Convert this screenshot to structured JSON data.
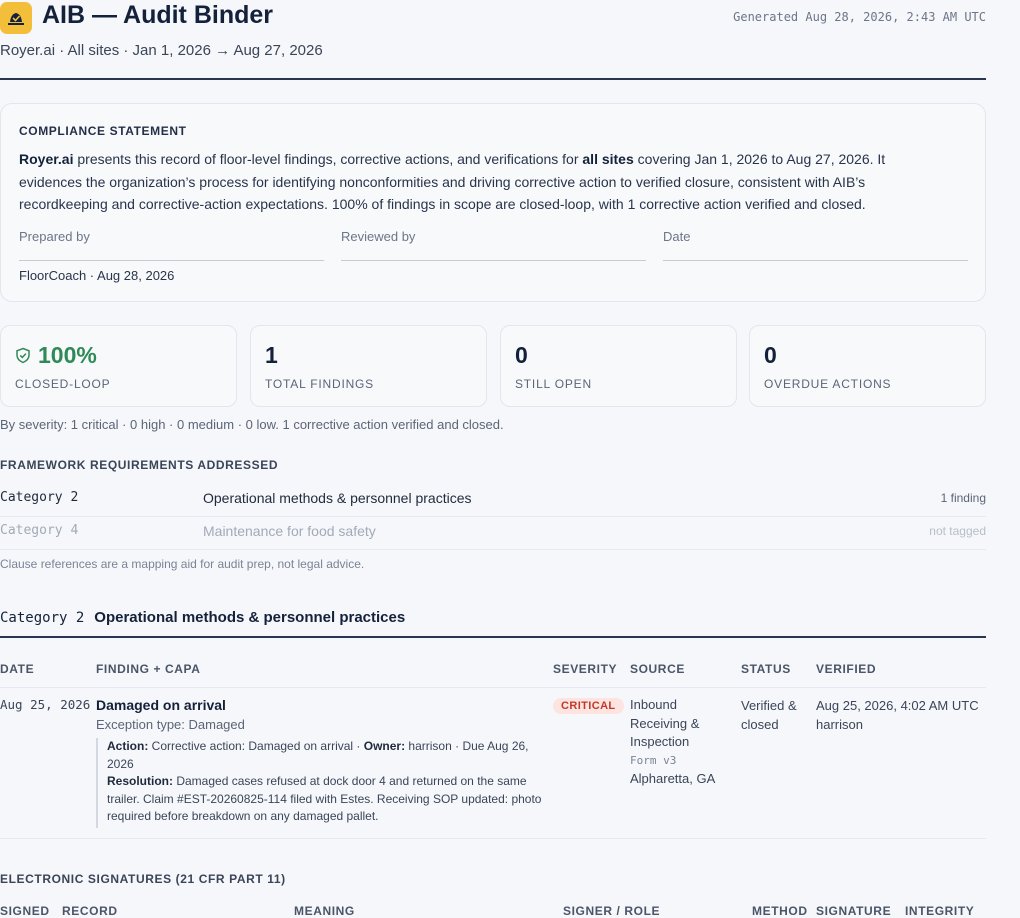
{
  "header": {
    "title": "AIB — Audit Binder",
    "generated": "Generated Aug 28, 2026, 2:43 AM UTC",
    "scope": "Royer.ai · All sites · Jan 1, 2026 → Aug 27, 2026",
    "logo_icon": "hardhat-icon",
    "logo_color": "#f3be3a"
  },
  "compliance": {
    "heading": "COMPLIANCE STATEMENT",
    "org": "Royer.ai",
    "text_1": " presents this record of floor-level findings, corrective actions, and verifications for ",
    "sites": "all sites",
    "text_2": " covering Jan 1, 2026 to Aug 27, 2026. It evidences the organization’s process for identifying nonconformities and driving corrective action to verified closure, consistent with AIB’s recordkeeping and corrective-action expectations. 100% of findings in scope are closed-loop, with 1 corrective action verified and closed.",
    "prepared_label": "Prepared by",
    "reviewed_label": "Reviewed by",
    "date_label": "Date",
    "prepared_value": "FloorCoach · Aug 28, 2026"
  },
  "stats": [
    {
      "value": "100%",
      "label": "CLOSED-LOOP",
      "icon": "shield-check-icon",
      "color": "#2f8a57"
    },
    {
      "value": "1",
      "label": "TOTAL FINDINGS"
    },
    {
      "value": "0",
      "label": "STILL OPEN"
    },
    {
      "value": "0",
      "label": "OVERDUE ACTIONS"
    }
  ],
  "severity_summary": "By severity: 1 critical · 0 high · 0 medium · 0 low. 1 corrective action verified and closed.",
  "framework": {
    "heading": "FRAMEWORK REQUIREMENTS ADDRESSED",
    "rows": [
      {
        "code": "Category 2",
        "name": "Operational methods & personnel practices",
        "count": "1 finding"
      },
      {
        "code": "Category 4",
        "name": "Maintenance for food safety",
        "count": "not tagged"
      }
    ],
    "disclaimer": "Clause references are a mapping aid for audit prep, not legal advice."
  },
  "category": {
    "code": "Category 2",
    "name": "Operational methods & personnel practices"
  },
  "table": {
    "headers": [
      "DATE",
      "FINDING + CAPA",
      "SEVERITY",
      "SOURCE",
      "STATUS",
      "VERIFIED"
    ],
    "row": {
      "date": "Aug 25, 2026",
      "title": "Damaged on arrival",
      "type": "Exception type: Damaged",
      "action_label": "Action:",
      "action_text": " Corrective action: Damaged on arrival · ",
      "owner_label": "Owner:",
      "owner_text": " harrison · Due Aug 26, 2026",
      "resolution_label": "Resolution:",
      "resolution_text": " Damaged cases refused at dock door 4 and returned on the same trailer. Claim #EST-20260825-114 filed with Estes. Receiving SOP updated: photo required before breakdown on any damaged pallet.",
      "severity": "CRITICAL",
      "source_1": "Inbound",
      "source_2": "Receiving &",
      "source_3": "Inspection",
      "source_form": "Form v3",
      "source_loc": "Alpharetta, GA",
      "status_1": "Verified &",
      "status_2": "closed",
      "verified_time": "Aug 25, 2026, 4:02 AM UTC",
      "verified_by": "harrison"
    }
  },
  "signatures": {
    "heading": "ELECTRONIC SIGNATURES (21 CFR PART 11)",
    "columns": [
      "SIGNED",
      "RECORD",
      "MEANING",
      "SIGNER / ROLE",
      "METHOD",
      "SIGNATURE",
      "INTEGRITY"
    ]
  }
}
